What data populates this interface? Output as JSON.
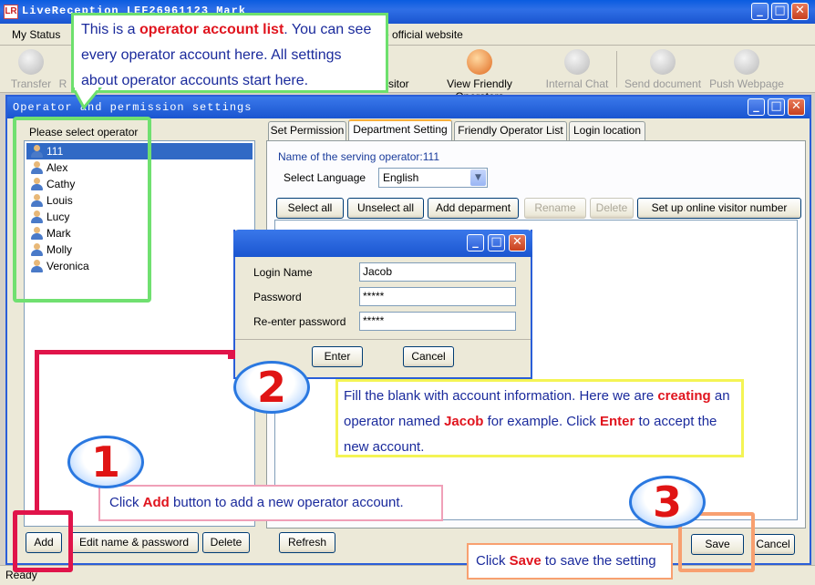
{
  "window": {
    "title": "LiveReception  LEF26961123 Mark",
    "app_icon": "LR"
  },
  "menu": [
    "My Status",
    "e official website"
  ],
  "toolbar": [
    {
      "label": "Transfer",
      "icon": "transfer-icon",
      "active": false
    },
    {
      "label": "R",
      "icon": "",
      "active": false
    },
    {
      "label": "isitor",
      "icon": "visitor-icon",
      "active": true
    },
    {
      "label": "View Friendly Operators",
      "icon": "operators-icon",
      "active": true
    },
    {
      "label": "Internal Chat",
      "icon": "chat-icon",
      "active": false
    },
    {
      "label": "Send document",
      "icon": "document-icon",
      "active": false
    },
    {
      "label": "Push Webpage",
      "icon": "globe-icon",
      "active": false
    }
  ],
  "dialog": {
    "title": "Operator and permission settings",
    "select_operator_label": "Please select operator",
    "operators": [
      "111",
      "Alex",
      "Cathy",
      "Louis",
      "Lucy",
      "Mark",
      "Molly",
      "Veronica"
    ],
    "selected_operator": "111",
    "tabs": [
      "Set Permission",
      "Department Setting",
      "Friendly Operator List",
      "Login location"
    ],
    "active_tab": "Department Setting",
    "serving_operator": "Name of the serving operator:111",
    "select_language_label": "Select Language",
    "language": "English",
    "dept_buttons": [
      {
        "label": "Select all",
        "enabled": true
      },
      {
        "label": "Unselect all",
        "enabled": true
      },
      {
        "label": "Add deparment",
        "enabled": true
      },
      {
        "label": "Rename",
        "enabled": false
      },
      {
        "label": "Delete",
        "enabled": false
      },
      {
        "label": "Set up online visitor number",
        "enabled": true
      }
    ],
    "bottom_buttons": {
      "add": "Add",
      "edit": "Edit name & password",
      "delete": "Delete",
      "refresh": "Refresh",
      "save": "Save",
      "cancel": "Cancel"
    }
  },
  "popup": {
    "login_name_label": "Login Name",
    "login_name_value": "Jacob",
    "password_label": "Password",
    "password_value": "*****",
    "reenter_label": "Re-enter password",
    "reenter_value": "*****",
    "enter_button": "Enter",
    "cancel_button": "Cancel"
  },
  "status": "Ready",
  "annotations": {
    "green": {
      "pre": "This is a ",
      "highlight": "operator account list",
      "post": ". You can see every operator account here. All settings about operator accounts start here."
    },
    "yellow": {
      "p1": "Fill the blank with account information. Here we are ",
      "h1": "creating",
      "p2": " an operator named ",
      "h2": "Jacob",
      "p3": " for example. Click ",
      "h3": "Enter",
      "p4": " to accept the new account."
    },
    "pink": {
      "pre": "Click ",
      "highlight": "Add",
      "post": " button to add a new operator account."
    },
    "orange": {
      "pre": "Click ",
      "highlight": "Save",
      "post": " to save the setting"
    },
    "badges": [
      "1",
      "2",
      "3"
    ]
  },
  "colors": {
    "highlight_red": "#e0141e",
    "annotation_text": "#1a2a9c",
    "green_frame": "#70e070",
    "red_frame": "#e0144a",
    "orange_frame": "#f8a070",
    "titlebar_blue": "#2a5ed8"
  }
}
